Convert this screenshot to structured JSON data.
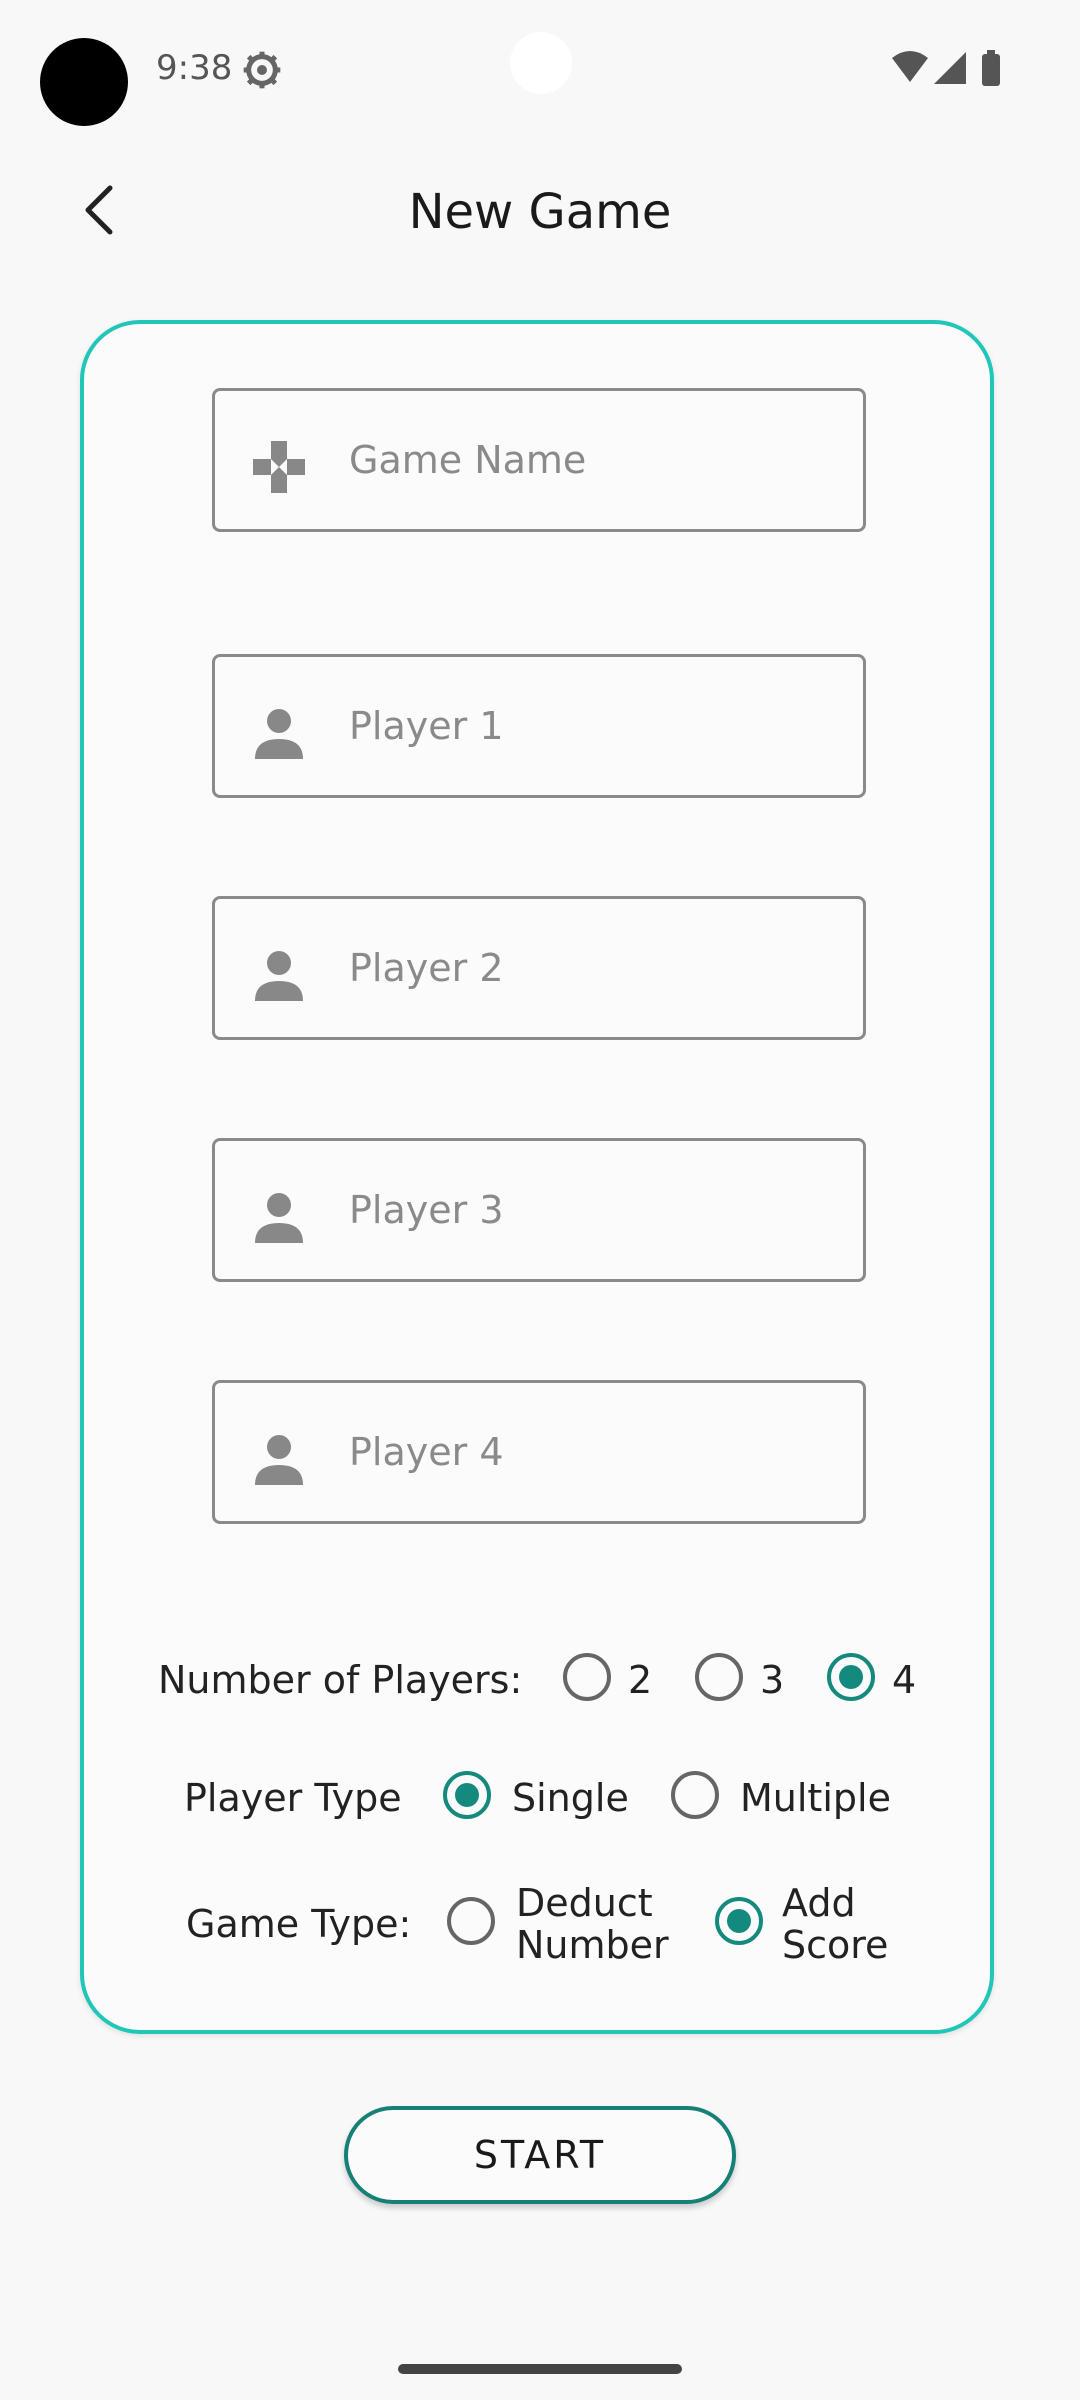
{
  "status_bar": {
    "time": "9:38",
    "icons": [
      "settings-gear-icon",
      "wifi-icon",
      "signal-icon",
      "battery-icon"
    ]
  },
  "app_bar": {
    "back_icon": "back-arrow-icon",
    "title": "New Game"
  },
  "form": {
    "game_name": {
      "placeholder": "Game Name",
      "value": "",
      "icon": "gamepad-icon"
    },
    "players": [
      {
        "placeholder": "Player 1",
        "value": "",
        "icon": "person-icon"
      },
      {
        "placeholder": "Player 2",
        "value": "",
        "icon": "person-icon"
      },
      {
        "placeholder": "Player 3",
        "value": "",
        "icon": "person-icon"
      },
      {
        "placeholder": "Player 4",
        "value": "",
        "icon": "person-icon"
      }
    ],
    "number_of_players": {
      "label": "Number of Players:",
      "options": [
        {
          "label": "2",
          "selected": false
        },
        {
          "label": "3",
          "selected": false
        },
        {
          "label": "4",
          "selected": true
        }
      ]
    },
    "player_type": {
      "label": "Player Type",
      "options": [
        {
          "label": "Single",
          "selected": true
        },
        {
          "label": "Multiple",
          "selected": false
        }
      ]
    },
    "game_type": {
      "label": "Game Type:",
      "options": [
        {
          "line1": "Deduct",
          "line2": "Number",
          "selected": false
        },
        {
          "line1": "Add",
          "line2": "Score",
          "selected": true
        }
      ]
    }
  },
  "start_button": {
    "label": "START"
  },
  "colors": {
    "accent": "#20c7b8",
    "radio_selected": "#148a7e",
    "button_border": "#178076",
    "background": "#f8f8f8"
  }
}
